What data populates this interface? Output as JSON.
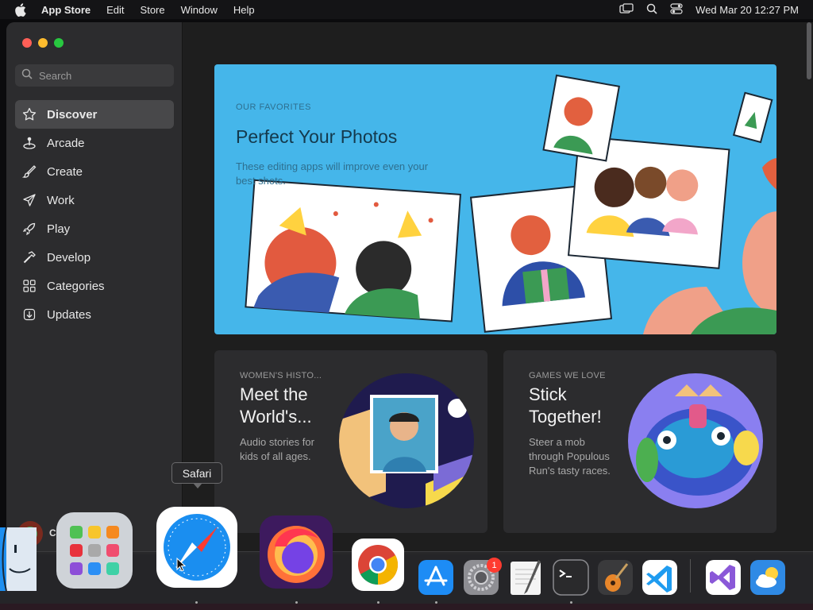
{
  "menubar": {
    "app_name": "App Store",
    "menus": [
      "Edit",
      "Store",
      "Window",
      "Help"
    ],
    "clock": "Wed Mar 20  12:27 PM",
    "icons": [
      "screen-mirror-icon",
      "spotlight-search-icon",
      "control-center-icon"
    ]
  },
  "sidebar": {
    "search_placeholder": "Search",
    "items": [
      {
        "label": "Discover",
        "icon": "star-icon",
        "active": true
      },
      {
        "label": "Arcade",
        "icon": "joystick-icon"
      },
      {
        "label": "Create",
        "icon": "brush-icon"
      },
      {
        "label": "Work",
        "icon": "paper-plane-icon"
      },
      {
        "label": "Play",
        "icon": "rocket-icon"
      },
      {
        "label": "Develop",
        "icon": "hammer-icon"
      },
      {
        "label": "Categories",
        "icon": "grid-icon"
      },
      {
        "label": "Updates",
        "icon": "download-icon"
      }
    ]
  },
  "hero": {
    "eyebrow": "OUR FAVORITES",
    "title": "Perfect Your Photos",
    "subtitle": "These editing apps will improve even your best shots."
  },
  "cards": [
    {
      "eyebrow": "WOMEN'S HISTO...",
      "title": "Meet the World's...",
      "description": "Audio stories for kids of all ages."
    },
    {
      "eyebrow": "GAMES WE LOVE",
      "title": "Stick Together!",
      "description": "Steer a mob through Populous Run's tasty races."
    }
  ],
  "tooltip": "Safari",
  "dock": {
    "apps": [
      "Finder",
      "Launchpad",
      "Safari",
      "Firefox",
      "Chrome",
      "App Store",
      "System Settings",
      "TextEdit",
      "Terminal",
      "GarageBand",
      "Visual Studio Code",
      "Visual Studio",
      "Weather"
    ],
    "system_settings_badge": "1",
    "partial_label": "Cal   Vi"
  },
  "colors": {
    "accent_blue": "#45b6ea",
    "window_bg": "#1e1e1e",
    "sidebar_bg": "#2c2c2e"
  }
}
